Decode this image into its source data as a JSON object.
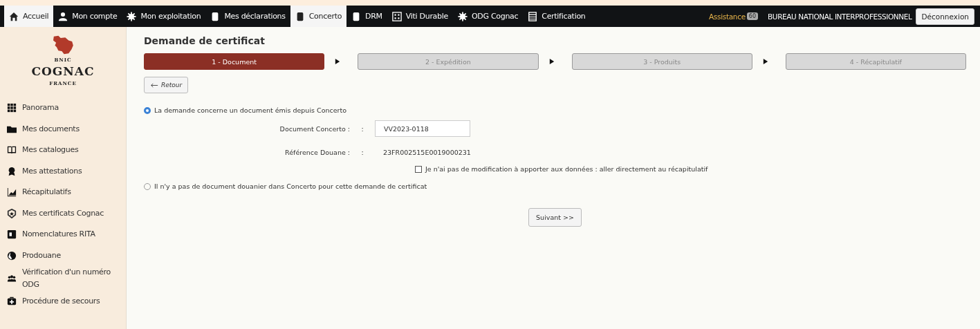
{
  "topnav": {
    "items": [
      {
        "label": "Accueil",
        "kind": "home",
        "selected": true
      },
      {
        "label": "Mon compte",
        "kind": "user",
        "selected": false
      },
      {
        "label": "Mon exploitation",
        "kind": "gear",
        "selected": false
      },
      {
        "label": "Mes déclarations",
        "kind": "doc",
        "selected": false
      },
      {
        "label": "Concerto",
        "kind": "doc",
        "selected": true
      },
      {
        "label": "DRM",
        "kind": "doc",
        "selected": false
      },
      {
        "label": "Viti Durable",
        "kind": "dice",
        "selected": false
      },
      {
        "label": "ODG Cognac",
        "kind": "gear",
        "selected": false
      },
      {
        "label": "Certification",
        "kind": "table",
        "selected": false
      }
    ],
    "assistance": {
      "label": "Assistance",
      "count": "60"
    },
    "organization": "BUREAU NATIONAL INTERPROFESSIONNEL",
    "logout": "Déconnexion"
  },
  "logo": {
    "top": "BNIC",
    "name": "COGNAC",
    "bottom": "FRANCE"
  },
  "sidebar": {
    "items": [
      {
        "label": "Panorama",
        "kind": "grid"
      },
      {
        "label": "Mes documents",
        "kind": "folder"
      },
      {
        "label": "Mes catalogues",
        "kind": "book"
      },
      {
        "label": "Mes attestations",
        "kind": "award"
      },
      {
        "label": "Récapitulatifs",
        "kind": "chart"
      },
      {
        "label": "Mes certificats Cognac",
        "kind": "badge"
      },
      {
        "label": "Nomenclatures RITA",
        "kind": "card"
      },
      {
        "label": "Prodouane",
        "kind": "globe"
      },
      {
        "label": "Vérification d'un numéro ODG",
        "kind": "people"
      },
      {
        "label": "Procédure de secours",
        "kind": "medkit"
      }
    ]
  },
  "page": {
    "title": "Demande de certificat",
    "steps": [
      {
        "label": "1 - Document",
        "selected": true
      },
      {
        "label": "2 - Expédition",
        "selected": false
      },
      {
        "label": "3 - Produits",
        "selected": false
      },
      {
        "label": "4 - Récapitulatif",
        "selected": false
      }
    ],
    "back_button": "Retour",
    "options": [
      {
        "label": "La demande concerne un document émis depuis Concerto",
        "selected": true
      },
      {
        "label": "Il n'y a pas de document douanier dans Concerto pour cette demande de certificat",
        "selected": false
      }
    ],
    "document_field": {
      "label": "Document Concerto :",
      "separator": ":",
      "value": "VV2023-0118"
    },
    "customs_reference": {
      "label": "Référence Douane :",
      "separator": ":",
      "value": "23FR002515E0019000231"
    },
    "skip_checkbox": {
      "label": "Je n'ai pas de modification à apporter aux données : aller directement au récapitulatif",
      "checked": false
    },
    "next_button": "Suivant >>"
  }
}
